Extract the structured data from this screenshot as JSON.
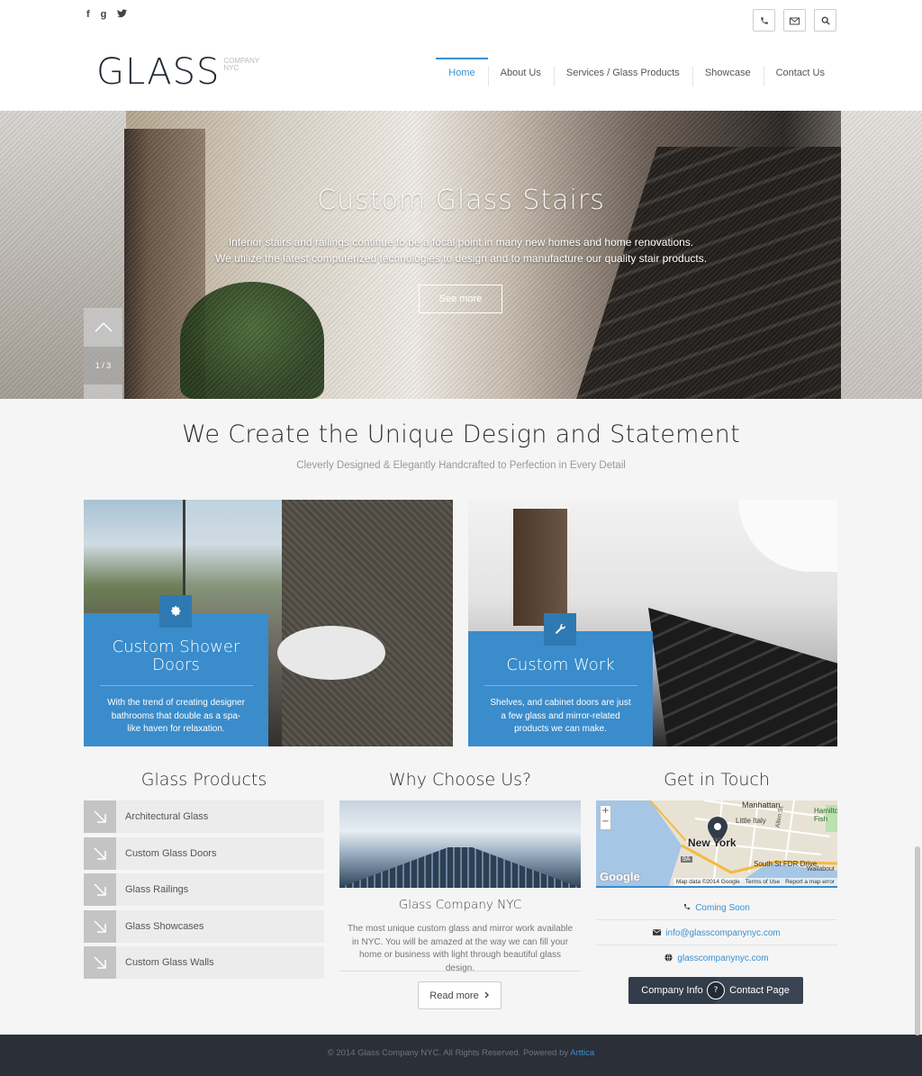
{
  "header": {
    "social": [
      "f",
      "g",
      "t"
    ],
    "social_icons": [
      "facebook-icon",
      "google-plus-icon",
      "twitter-icon"
    ],
    "tools": [
      "phone-icon",
      "envelope-icon",
      "search-icon"
    ],
    "logo": {
      "main": "GLASS",
      "sub1": "COMPANY",
      "sub2": "NYC"
    },
    "nav": [
      {
        "label": "Home",
        "active": true
      },
      {
        "label": "About Us"
      },
      {
        "label": "Services / Glass Products"
      },
      {
        "label": "Showcase"
      },
      {
        "label": "Contact Us"
      }
    ]
  },
  "hero": {
    "title": "Custom Glass Stairs",
    "text_line1": "Interior stairs and railings continue to be a focal point in many new homes and home renovations.",
    "text_line2": "We utilize the latest computerized technologies to design and to manufacture our quality stair products.",
    "button": "See more",
    "counter": "1 / 3"
  },
  "intro": {
    "headline": "We Create the Unique Design and Statement",
    "subline": "Cleverly Designed & Elegantly Handcrafted to Perfection in Every Detail"
  },
  "cards": [
    {
      "title": "Custom Shower Doors",
      "desc": "With the trend of creating designer bathrooms that double as a spa-like haven for relaxation.",
      "icon": "gear-icon"
    },
    {
      "title": "Custom Work",
      "desc": "Shelves, and cabinet doors are just a few glass and mirror-related products we can make.",
      "icon": "wrench-icon"
    }
  ],
  "products": {
    "title": "Glass Products",
    "items": [
      "Architectural Glass",
      "Custom Glass Doors",
      "Glass Railings",
      "Glass Showcases",
      "Custom Glass Walls"
    ]
  },
  "why": {
    "title": "Why Choose Us?",
    "name": "Glass Company NYC",
    "text": "The most unique custom glass and mirror work available in NYC.  You will be amazed at the way we can fill your home or business with light through beautiful glass design.",
    "button": "Read more"
  },
  "contact": {
    "title": "Get in Touch",
    "map": {
      "labels": {
        "manhattan": "Manhattan",
        "city": "New York",
        "little_italy": "Little Italy",
        "hamilton": "Hamilton Fish",
        "fdr": "South St FDR Drive",
        "wallabout": "Wallabout",
        "google": "Google",
        "map_data": "Map data ©2014 Google",
        "terms": "Terms of Use",
        "report": "Report a map error",
        "allen": "Allen St",
        "badge": "9A"
      }
    },
    "phone": "Coming Soon",
    "email": "info@glasscompanynyc.com",
    "web": "glasscompanynyc.com",
    "btn_left": "Company Info",
    "btn_or": "?",
    "btn_right": "Contact Page"
  },
  "footer": {
    "text": "© 2014 Glass Company NYC.  All Rights Reserved. Powered by",
    "link": "Arttica"
  }
}
